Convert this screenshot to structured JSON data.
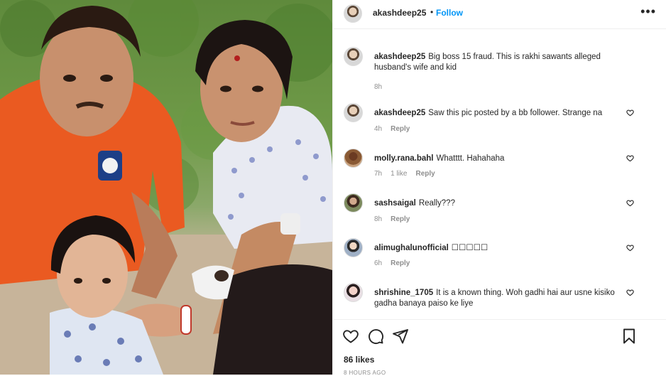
{
  "post": {
    "author": "akashdeep25",
    "follow_label": "Follow",
    "dot": "•",
    "more_label": "•••",
    "likes": "86 likes",
    "time_ago": "8 HOURS AGO"
  },
  "comments": [
    {
      "user": "akashdeep25",
      "text": "Big boss 15 fraud. This is rakhi sawants alleged husband's wife and kid",
      "time": "8h",
      "likes": "",
      "reply": ""
    },
    {
      "user": "akashdeep25",
      "text": "Saw this pic posted by a bb follower. Strange na",
      "time": "4h",
      "likes": "",
      "reply": "Reply"
    },
    {
      "user": "molly.rana.bahl",
      "text": "Whatttt. Hahahaha",
      "time": "7h",
      "likes": "1 like",
      "reply": "Reply"
    },
    {
      "user": "sashsaigal",
      "text": "Really???",
      "time": "8h",
      "likes": "",
      "reply": "Reply"
    },
    {
      "user": "alimughalunofficial",
      "text": "☐☐☐☐☐",
      "time": "6h",
      "likes": "",
      "reply": "Reply"
    },
    {
      "user": "shrishine_1705",
      "text": "It is a known thing. Woh gadhi hai aur usne kisiko gadha banaya paiso ke liye",
      "time": "",
      "likes": "",
      "reply": ""
    }
  ],
  "icons": {
    "like": "heart-icon",
    "comment": "comment-icon",
    "share": "share-icon",
    "save": "bookmark-icon",
    "more": "more-icon"
  },
  "colors": {
    "follow": "#0095f6",
    "meta": "#8e8e8e",
    "text": "#262626"
  }
}
